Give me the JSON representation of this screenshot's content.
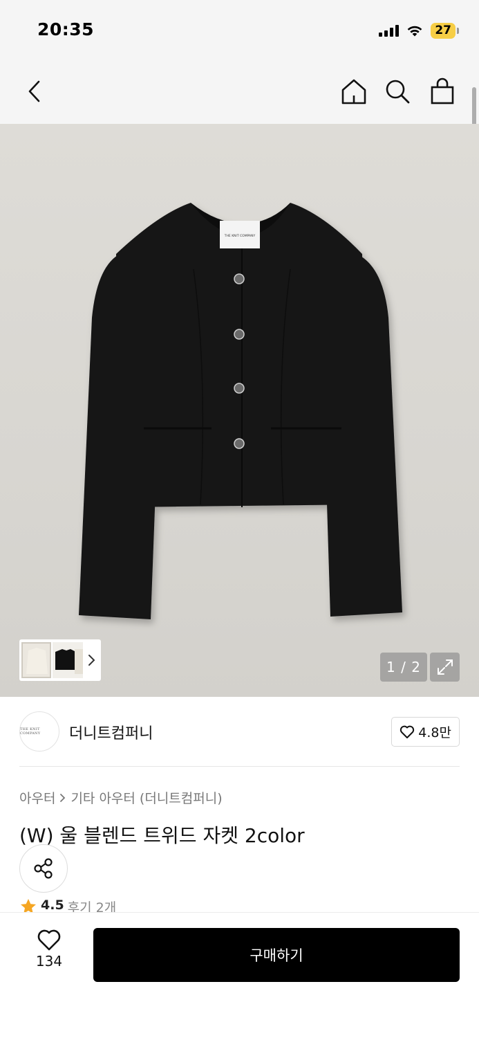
{
  "status_bar": {
    "time": "20:35",
    "battery": "27"
  },
  "nav": {
    "icons": [
      "chevron-left-icon",
      "home-icon",
      "search-icon",
      "shopping-bag-icon"
    ]
  },
  "gallery": {
    "page_indicator": "1 / 2",
    "brand_label": "THE KNIT COMPANY"
  },
  "brand": {
    "logo_text": "THE KNIT COMPANY",
    "name": "더니트컴퍼니",
    "likes": "4.8만"
  },
  "breadcrumb": {
    "category": "아우터",
    "subcategory": "기타 아우터 (더니트컴퍼니)"
  },
  "product": {
    "title": "(W) 울 블렌드 트위드 자켓 2color",
    "rating": "4.5",
    "reviews": "후기 2개"
  },
  "bottom": {
    "wish_count": "134",
    "buy_label": "구매하기"
  },
  "colors": {
    "buy_button": "#000000",
    "star": "#f5a623",
    "battery": "#f7ce46"
  }
}
